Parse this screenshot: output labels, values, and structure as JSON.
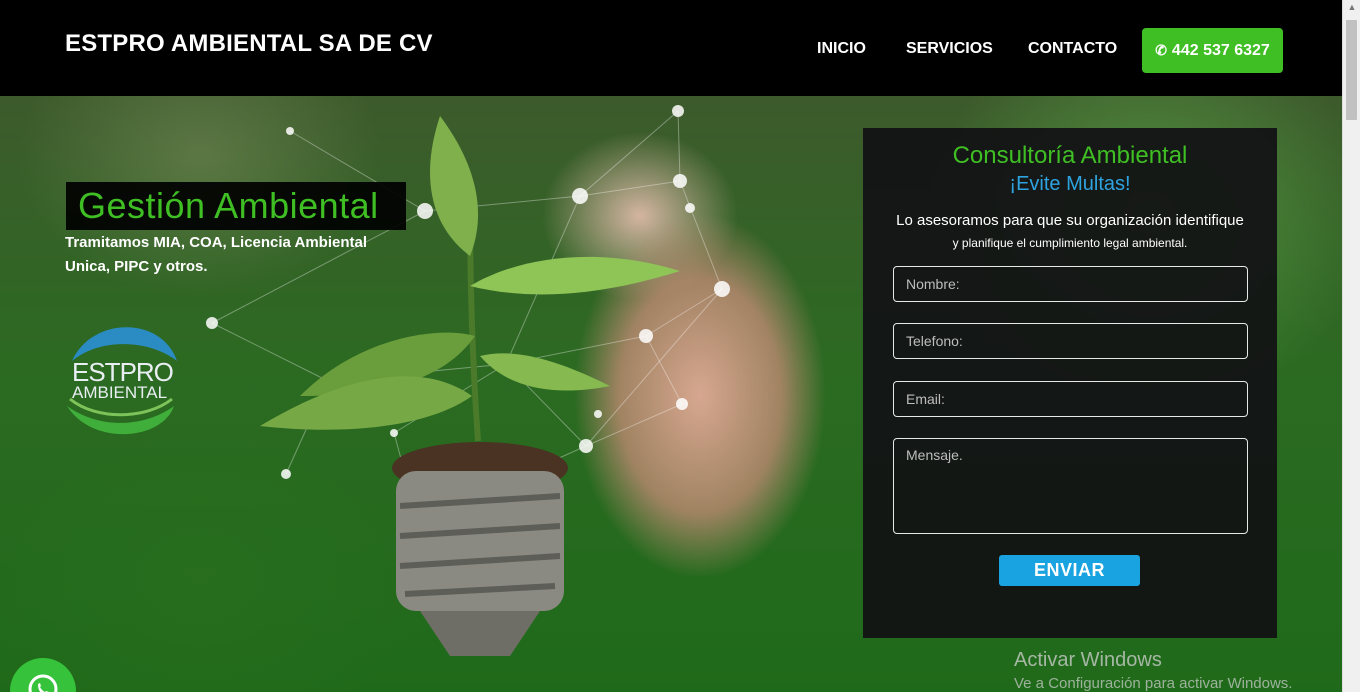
{
  "header": {
    "brand": "ESTPRO AMBIENTAL SA DE CV",
    "nav": [
      "INICIO",
      "SERVICIOS",
      "CONTACTO"
    ],
    "phone": "442 537 6327",
    "phone_icon": "phone-icon"
  },
  "hero": {
    "title": "Gestión Ambiental",
    "subtitle": "Tramitamos MIA, COA, Licencia Ambiental Unica, PIPC y otros.",
    "logo": {
      "line1": "ESTPRO",
      "line2": "AMBIENTAL"
    }
  },
  "form": {
    "title": "Consultoría Ambiental",
    "subtitle": "¡Evite Multas!",
    "desc1": "Lo asesoramos para que su organización identifique",
    "desc2": "y planifique el cumplimiento legal ambiental.",
    "placeholders": {
      "nombre": "Nombre:",
      "telefono": "Telefono:",
      "email": "Email:",
      "mensaje": "Mensaje."
    },
    "submit": "ENVIAR"
  },
  "watermark": {
    "line1": "Activar Windows",
    "line2": "Ve a Configuración para activar Windows."
  },
  "colors": {
    "accent_green": "#3fbf24",
    "accent_blue": "#19a3e0",
    "whatsapp": "#36c23b"
  }
}
